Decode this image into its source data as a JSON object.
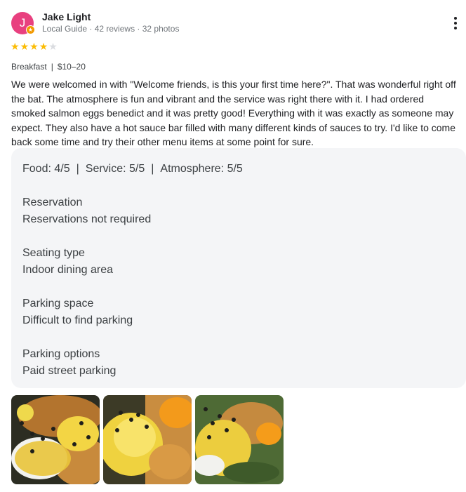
{
  "reviewer": {
    "initial": "J",
    "name": "Jake Light",
    "meta": "Local Guide · 42 reviews · 32 photos",
    "avatar_color": "#e8407f",
    "badge_icon": "local-guide-star-icon"
  },
  "menu_icon": "more-vert-icon",
  "rating": {
    "value": 4,
    "max": 5,
    "star_color": "#fbbc04"
  },
  "tags": {
    "meal": "Breakfast",
    "price": "$10–20"
  },
  "review_text": "We were welcomed in with \"Welcome friends, is this your first time here?\". That was wonderful right off the bat. The atmosphere is fun and vibrant and the service was right there with it. I had ordered smoked salmon eggs benedict and it was pretty good! Everything with it was exactly as someone may expect. They also have a hot sauce bar filled with many different kinds of sauces to try. I'd like to come back some time and try their other menu items at some point for sure.",
  "scores": {
    "food": "Food: 4/5",
    "service": "Service: 5/5",
    "atmosphere": "Atmosphere: 5/5"
  },
  "details": [
    {
      "label": "Reservation",
      "value": "Reservations not required"
    },
    {
      "label": "Seating type",
      "value": "Indoor dining area"
    },
    {
      "label": "Parking space",
      "value": "Difficult to find parking"
    },
    {
      "label": "Parking options",
      "value": "Paid street parking"
    }
  ],
  "photos": [
    {
      "subject": "eggs-benedict-photo"
    },
    {
      "subject": "eggs-benedict-photo"
    },
    {
      "subject": "eggs-benedict-photo"
    }
  ]
}
